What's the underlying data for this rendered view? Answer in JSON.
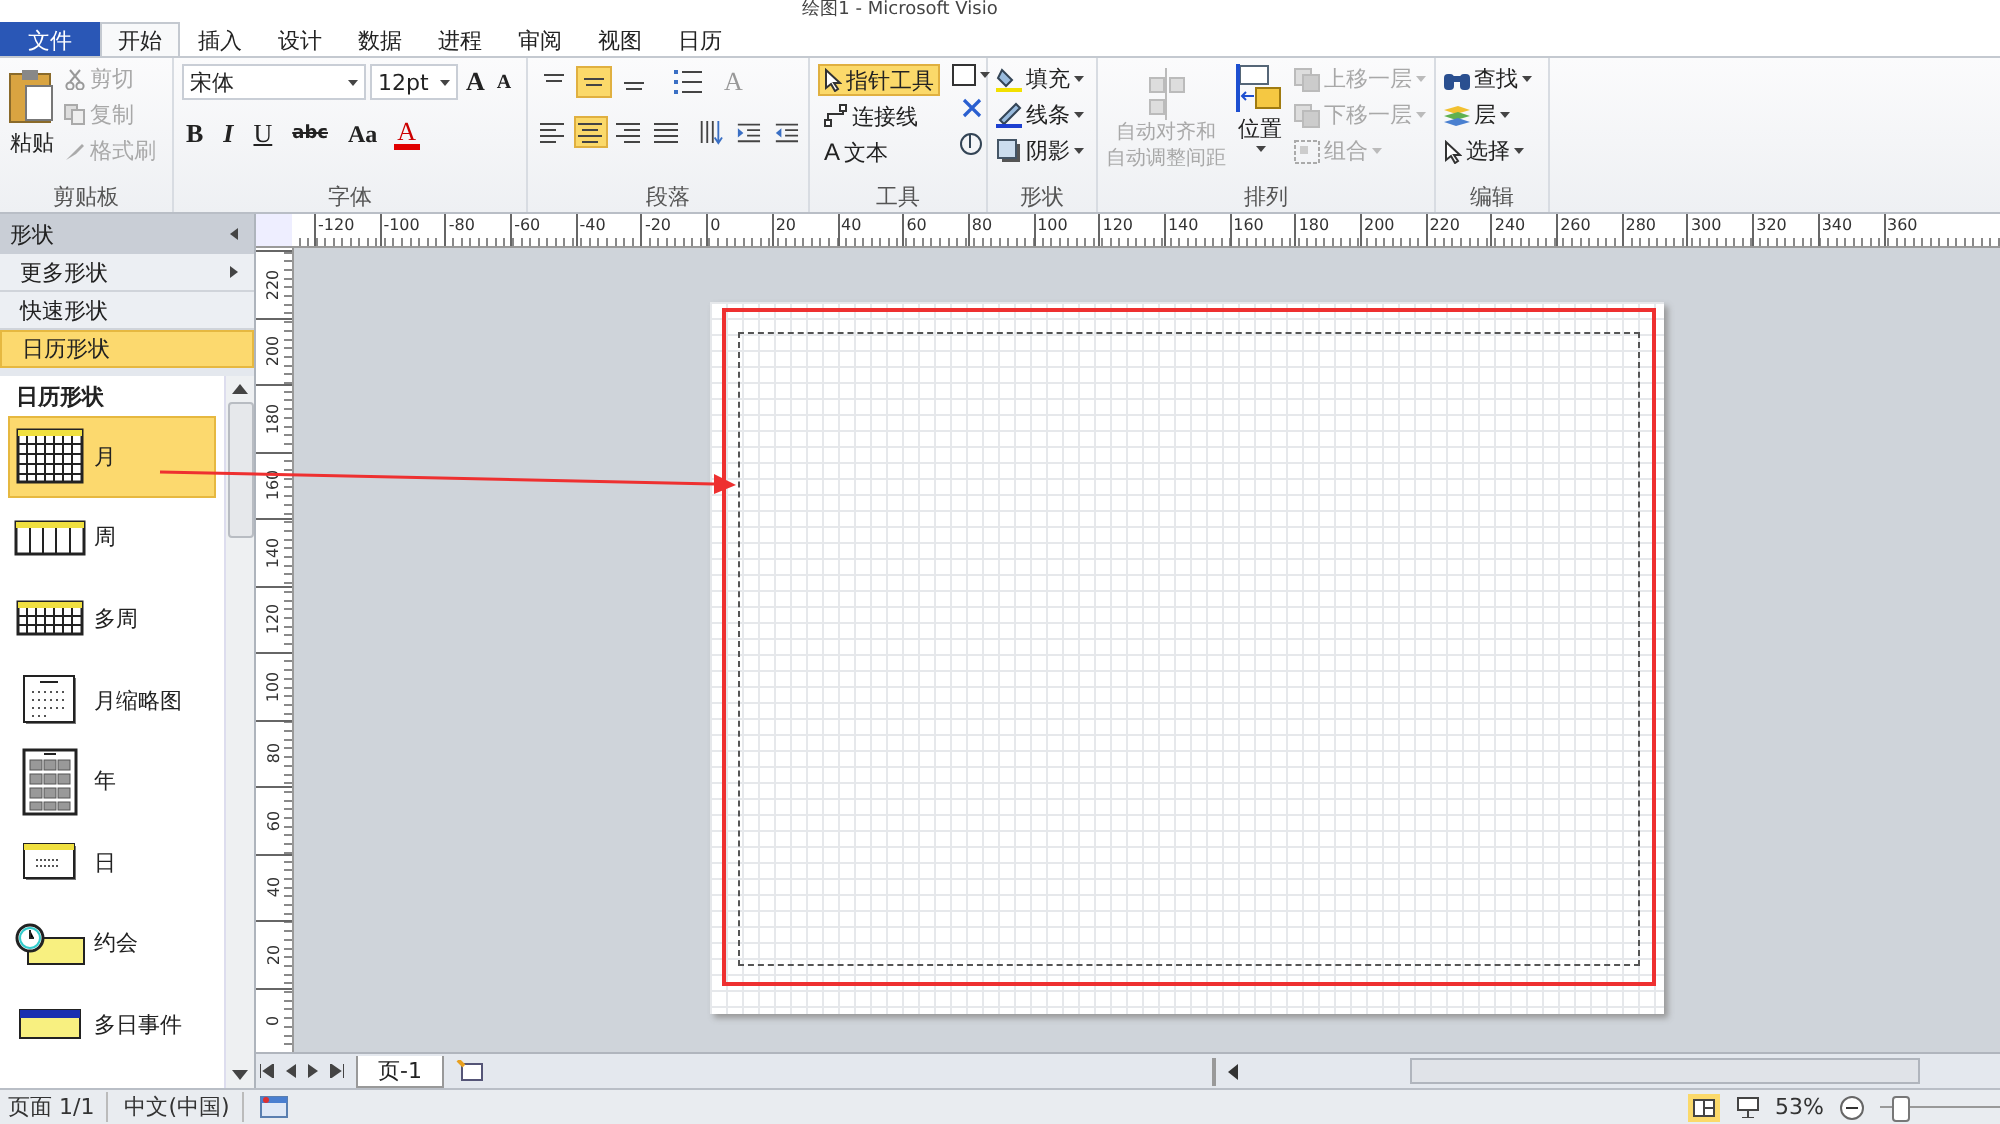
{
  "window": {
    "title": "绘图1 - Microsoft Visio"
  },
  "tabs": [
    {
      "label": "文件",
      "kind": "file",
      "selected": false
    },
    {
      "label": "开始",
      "kind": "tab",
      "selected": true
    },
    {
      "label": "插入",
      "kind": "tab",
      "selected": false
    },
    {
      "label": "设计",
      "kind": "tab",
      "selected": false
    },
    {
      "label": "数据",
      "kind": "tab",
      "selected": false
    },
    {
      "label": "进程",
      "kind": "tab",
      "selected": false
    },
    {
      "label": "审阅",
      "kind": "tab",
      "selected": false
    },
    {
      "label": "视图",
      "kind": "tab",
      "selected": false
    },
    {
      "label": "日历",
      "kind": "tab",
      "selected": false
    }
  ],
  "clipboard": {
    "label": "剪贴板",
    "paste": "粘贴",
    "items": [
      {
        "label": "剪切",
        "kind": "cut",
        "disabled": true
      },
      {
        "label": "复制",
        "kind": "copy",
        "disabled": true
      },
      {
        "label": "格式刷",
        "kind": "brush",
        "disabled": true
      }
    ]
  },
  "font": {
    "label": "字体",
    "family": "宋体",
    "size": "12pt",
    "grow": "A",
    "shrink": "A",
    "buttons": [
      {
        "label": "B",
        "kind": "bold"
      },
      {
        "label": "I",
        "kind": "italic"
      },
      {
        "label": "U",
        "kind": "underline"
      },
      {
        "label": "abc",
        "kind": "strike"
      },
      {
        "label": "Aa",
        "kind": "case"
      },
      {
        "label": "A",
        "kind": "color"
      }
    ]
  },
  "paragraph": {
    "label": "段落",
    "text_size": "A",
    "top_row": [
      {
        "kind": "top",
        "selected": false
      },
      {
        "kind": "middle",
        "selected": true
      },
      {
        "kind": "bottom",
        "selected": false
      }
    ],
    "bottom_row": [
      {
        "kind": "left",
        "selected": false
      },
      {
        "kind": "center",
        "selected": true
      },
      {
        "kind": "right",
        "selected": false
      },
      {
        "kind": "justify",
        "selected": false
      }
    ]
  },
  "tools": {
    "label": "工具",
    "items": [
      {
        "label": "指针工具",
        "kind": "pointer",
        "selected": true
      },
      {
        "label": "连接线",
        "kind": "connector",
        "selected": false
      },
      {
        "label": "文本",
        "kind": "text",
        "glyph": "A",
        "selected": false
      }
    ]
  },
  "shape_group": {
    "label": "形状",
    "items": [
      {
        "label": "填充",
        "kind": "fill"
      },
      {
        "label": "线条",
        "kind": "line"
      },
      {
        "label": "阴影",
        "kind": "shadow"
      }
    ]
  },
  "arrange": {
    "label": "排列",
    "auto_align": [
      "自动对齐和",
      "自动调整间距"
    ],
    "position": "位置",
    "items": [
      {
        "label": "上移一层",
        "kind": "forward",
        "disabled": true
      },
      {
        "label": "下移一层",
        "kind": "backward",
        "disabled": true
      },
      {
        "label": "组合",
        "kind": "group",
        "disabled": true
      }
    ]
  },
  "editing": {
    "label": "编辑",
    "items": [
      {
        "label": "查找",
        "kind": "find"
      },
      {
        "label": "层",
        "kind": "layers"
      },
      {
        "label": "选择",
        "kind": "select"
      }
    ]
  },
  "sidebar": {
    "title": "形状",
    "nav": [
      {
        "label": "更多形状",
        "selected": false,
        "arrow": true
      },
      {
        "label": "快速形状",
        "selected": false,
        "arrow": false
      },
      {
        "label": "日历形状",
        "selected": true,
        "arrow": false
      }
    ],
    "stencil_title": "日历形状",
    "items": [
      {
        "label": "月",
        "kind": "month",
        "selected": true
      },
      {
        "label": "周",
        "kind": "week",
        "selected": false
      },
      {
        "label": "多周",
        "kind": "multiweek",
        "selected": false
      },
      {
        "label": "月缩略图",
        "kind": "thumbnail",
        "selected": false
      },
      {
        "label": "年",
        "kind": "year",
        "selected": false
      },
      {
        "label": "日",
        "kind": "day",
        "selected": false
      },
      {
        "label": "约会",
        "kind": "appointment",
        "selected": false
      },
      {
        "label": "多日事件",
        "kind": "event",
        "selected": false
      }
    ]
  },
  "ruler": {
    "horizontal": [
      "-120",
      "-100",
      "-80",
      "-60",
      "-40",
      "-20",
      "0",
      "20",
      "40",
      "60",
      "80",
      "100",
      "120",
      "140",
      "160",
      "180",
      "200",
      "220",
      "240",
      "260",
      "280",
      "300",
      "320",
      "340",
      "360"
    ],
    "vertical": [
      "220",
      "200",
      "180",
      "160",
      "140",
      "120",
      "100",
      "80",
      "60",
      "40",
      "20",
      "0"
    ]
  },
  "page_tabs": [
    {
      "label": "页-1",
      "selected": true
    }
  ],
  "status_bar": {
    "page": "页面 1/1",
    "language": "中文(中国)",
    "zoom": "53%",
    "zoom_slider": {
      "level": 0.1
    }
  }
}
